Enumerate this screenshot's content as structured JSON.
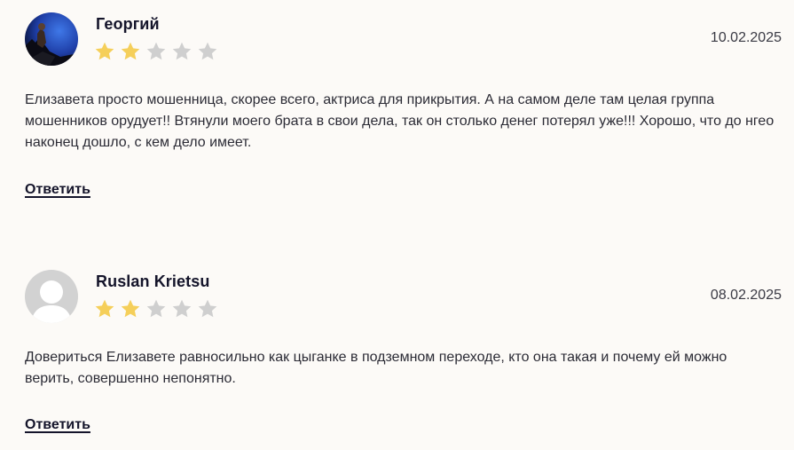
{
  "colors": {
    "background": "#fcfaf7",
    "star_filled": "#f5cf5a",
    "star_empty": "#cfcfcf",
    "text": "#2b2b35"
  },
  "reviews": [
    {
      "author": "Георгий",
      "date": "10.02.2025",
      "rating": 2,
      "max_rating": 5,
      "text": "Елизавета просто мошенница, скорее всего, актриса для прикрытия. А на самом деле там целая группа мошенников орудует!! Втянули моего брата в свои дела, так он столько денег потерял уже!!! Хорошо, что до нгео наконец дошло, с кем дело имеет.",
      "reply_label": "Ответить",
      "avatar_icon": "user-photo"
    },
    {
      "author": "Ruslan Krietsu",
      "date": "08.02.2025",
      "rating": 2,
      "max_rating": 5,
      "text": "Довериться Елизавете равносильно как цыганке в подземном переходе, кто она такая и почему ей можно верить, совершенно непонятно.",
      "reply_label": "Ответить",
      "avatar_icon": "default-user-avatar-icon"
    }
  ]
}
